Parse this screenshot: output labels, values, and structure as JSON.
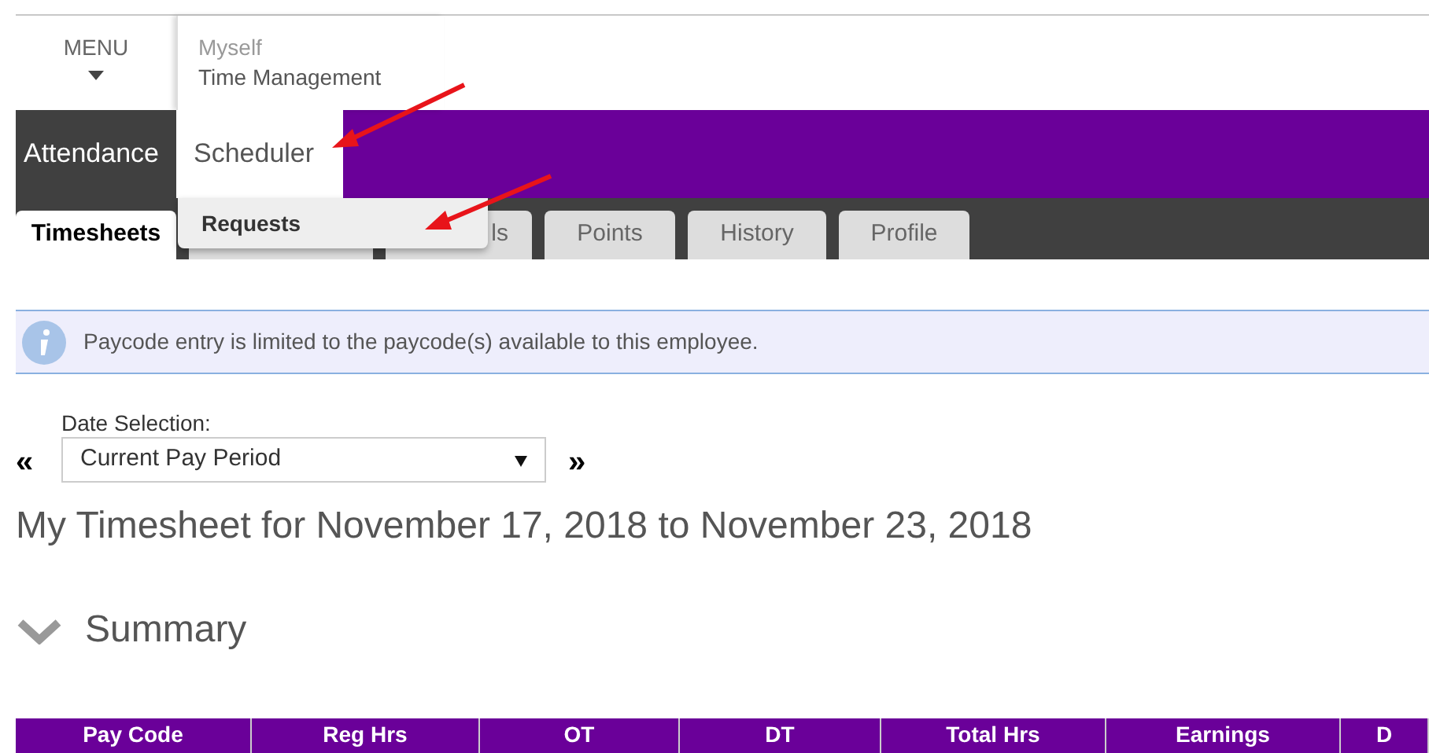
{
  "header": {
    "menu_label": "MENU",
    "breadcrumb": [
      "Myself",
      "Time Management"
    ]
  },
  "nav_items": [
    {
      "label": "Attendance",
      "selected": false
    },
    {
      "label": "Scheduler",
      "selected": true
    }
  ],
  "dropdown": {
    "items": [
      {
        "label": "Requests"
      }
    ]
  },
  "tabs": [
    {
      "label": "Timesheets",
      "selected": true
    },
    {
      "selected": false
    },
    {
      "label": "ls",
      "selected": false
    },
    {
      "label": "Points",
      "selected": false
    },
    {
      "label": "History",
      "selected": false
    },
    {
      "label": "Profile",
      "selected": false
    }
  ],
  "info_message": "Paycode entry is limited to the paycode(s) available to this employee.",
  "date_selection": {
    "label": "Date Selection:",
    "value": "Current Pay Period",
    "prev": "«",
    "next": "»"
  },
  "heading": "My Timesheet for November 17, 2018 to November 23, 2018",
  "summary": {
    "title": "Summary",
    "expanded": true
  },
  "table": {
    "columns": [
      "Pay Code",
      "Reg Hrs",
      "OT",
      "DT",
      "Total Hrs",
      "Earnings",
      "D"
    ]
  }
}
